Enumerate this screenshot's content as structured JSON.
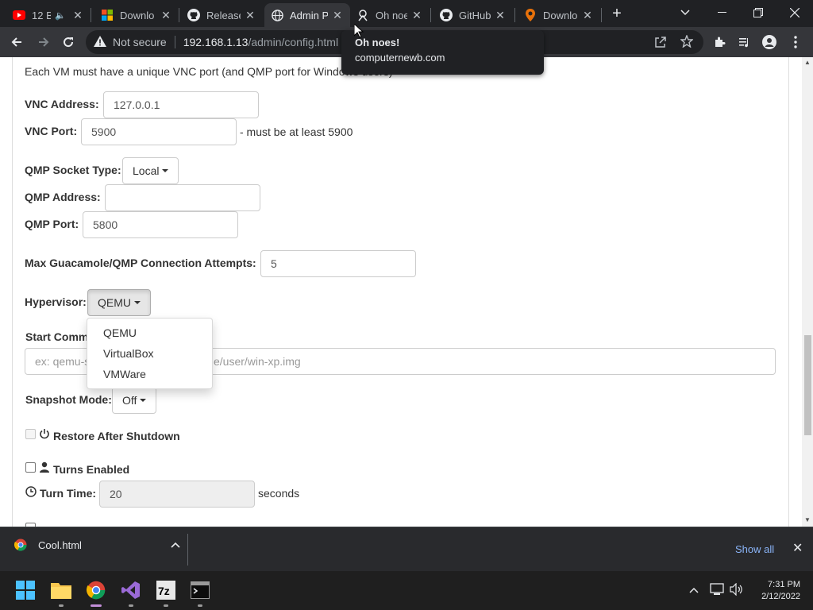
{
  "browser": {
    "tabs": [
      {
        "title": "12 B",
        "icon": "youtube-icon"
      },
      {
        "title": "Downlo",
        "icon": "windows-logo-icon"
      },
      {
        "title": "Release",
        "icon": "github-icon"
      },
      {
        "title": "Admin P",
        "icon": "globe-icon",
        "active": true
      },
      {
        "title": "Oh noe",
        "icon": "computernewb-icon"
      },
      {
        "title": "GitHub",
        "icon": "github-icon"
      },
      {
        "title": "Downlo",
        "icon": "pin-icon"
      }
    ],
    "address": {
      "security_label": "Not secure",
      "host": "192.168.1.13",
      "path": "/admin/config.html"
    },
    "tooltip": {
      "title": "Oh noes!",
      "domain": "computernewb.com"
    }
  },
  "page": {
    "intro": "Each VM must have a unique VNC port (and QMP port for Windows users)",
    "vnc_address_label": "VNC Address:",
    "vnc_address_value": "127.0.0.1",
    "vnc_port_label": "VNC Port:",
    "vnc_port_value": "5900",
    "vnc_port_hint": "- must be at least 5900",
    "qmp_socket_label": "QMP Socket Type:",
    "qmp_socket_value": "Local",
    "qmp_address_label": "QMP Address:",
    "qmp_address_value": "",
    "qmp_port_label": "QMP Port:",
    "qmp_port_value": "5800",
    "max_attempts_label": "Max Guacamole/QMP Connection Attempts:",
    "max_attempts_value": "5",
    "hypervisor_label": "Hypervisor:",
    "hypervisor_value": "QEMU",
    "hypervisor_options": [
      "QEMU",
      "VirtualBox",
      "VMWare"
    ],
    "start_command_label": "Start Comm",
    "start_command_placeholder_left": "ex: qemu-s",
    "start_command_placeholder_right": "e/user/win-xp.img",
    "snapshot_label": "Snapshot Mode:",
    "snapshot_value": "Off",
    "restore_label": "Restore After Shutdown",
    "turns_label": "Turns Enabled",
    "turn_time_label": "Turn Time:",
    "turn_time_value": "20",
    "turn_time_unit": "seconds"
  },
  "downloads": {
    "file": "Cool.html",
    "show_all": "Show all"
  },
  "taskbar": {
    "time": "7:31 PM",
    "date": "2/12/2022"
  }
}
